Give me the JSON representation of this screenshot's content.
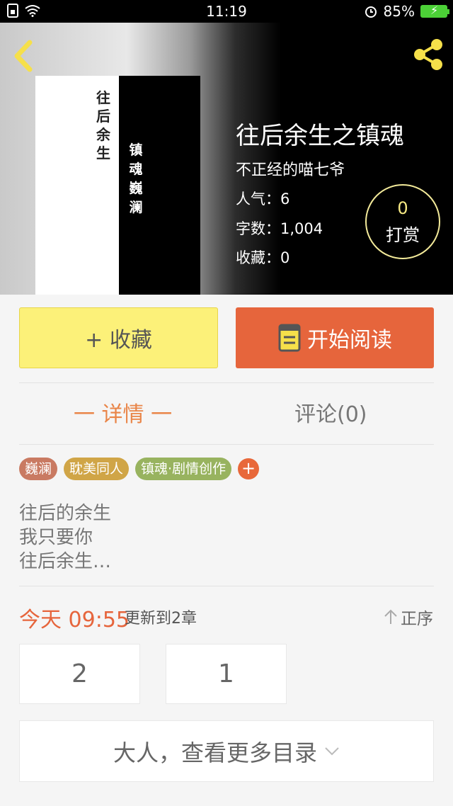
{
  "status_bar": {
    "time": "11:19",
    "battery": "85%"
  },
  "header": {
    "title": "往后余生之镇魂",
    "author": "不正经的喵七爷",
    "popularity": "人气：6",
    "word_count": "字数：1,004",
    "favorites": "收藏：0",
    "tip": {
      "count": "0",
      "label": "打赏"
    },
    "cover": {
      "text_left": "往后余生",
      "text_right": "镇魂巍澜"
    }
  },
  "actions": {
    "favorite_label": "+ 收藏",
    "read_label": "开始阅读"
  },
  "tabs": {
    "detail": "一 详情 一",
    "comments": "评论(0)"
  },
  "tags": [
    {
      "label": "巍澜",
      "color": "#c97a62"
    },
    {
      "label": "耽美同人",
      "color": "#d0a547"
    },
    {
      "label": "镇魂·剧情创作",
      "color": "#98b35f"
    }
  ],
  "tag_add": "+",
  "description": [
    "往后的余生",
    "我只要你",
    "往后余生…"
  ],
  "update": {
    "time": "今天 09:55",
    "text": "更新到2章",
    "order": "正序"
  },
  "chapters": [
    "2",
    "1"
  ],
  "more_catalog": "大人，查看更多目录",
  "colors": {
    "accent": "#e6653c",
    "favorite_bg": "#fcf179",
    "icon_yellow": "#f6e04a"
  }
}
